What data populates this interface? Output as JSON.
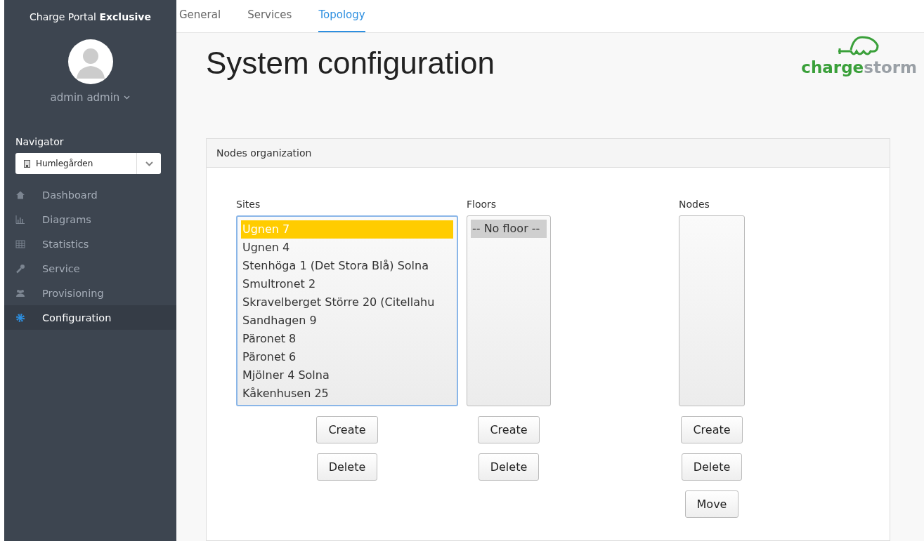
{
  "sidebar": {
    "brand": "Charge Portal",
    "brand_bold": "Exclusive",
    "user": "admin admin",
    "navigator_label": "Navigator",
    "navigator_select": "Humlegården",
    "items": [
      {
        "label": "Dashboard",
        "kind": "home",
        "selected": false
      },
      {
        "label": "Diagrams",
        "kind": "chart",
        "selected": false
      },
      {
        "label": "Statistics",
        "kind": "table",
        "selected": false
      },
      {
        "label": "Service",
        "kind": "wrench",
        "selected": false
      },
      {
        "label": "Provisioning",
        "kind": "users",
        "selected": false
      },
      {
        "label": "Configuration",
        "kind": "gear",
        "selected": true
      }
    ]
  },
  "tabs": [
    {
      "label": "General",
      "selected": false
    },
    {
      "label": "Services",
      "selected": false
    },
    {
      "label": "Topology",
      "selected": true
    }
  ],
  "title": "System configuration",
  "logo": {
    "text_green": "charge",
    "text_gray": "storm"
  },
  "panel": {
    "title": "Nodes organization",
    "columns": [
      {
        "label": "Sites",
        "focused": true,
        "items": [
          {
            "label": "Ugnen 7",
            "selected": true
          },
          {
            "label": "Ugnen 4",
            "selected": false
          },
          {
            "label": "Stenhöga 1 (Det Stora Blå) Solna",
            "selected": false
          },
          {
            "label": "Smultronet 2",
            "selected": false
          },
          {
            "label": "Skravelberget Större 20 (Citellahu",
            "selected": false
          },
          {
            "label": "Sandhagen 9",
            "selected": false
          },
          {
            "label": "Päronet 8",
            "selected": false
          },
          {
            "label": "Päronet 6",
            "selected": false
          },
          {
            "label": "Mjölner 4 Solna",
            "selected": false
          },
          {
            "label": "Kåkenhusen 25",
            "selected": false
          }
        ],
        "buttons": [
          "Create",
          "Delete"
        ]
      },
      {
        "label": "Floors",
        "focused": false,
        "items": [
          {
            "label": "-- No floor --",
            "selected": true
          }
        ],
        "buttons": [
          "Create",
          "Delete"
        ]
      },
      {
        "label": "Nodes",
        "focused": false,
        "buttons": [
          "Create",
          "Delete",
          "Move"
        ]
      }
    ]
  }
}
